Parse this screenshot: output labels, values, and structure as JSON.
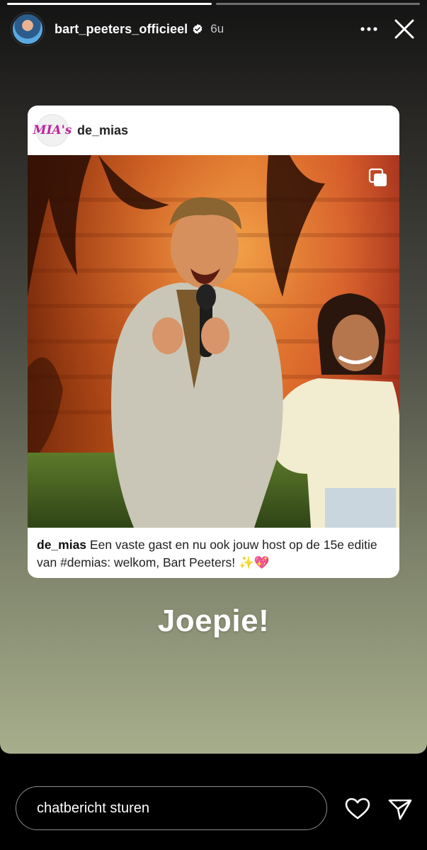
{
  "story": {
    "progress": [
      1.0,
      0.0
    ],
    "header": {
      "username": "bart_peeters_officieel",
      "time": "6u",
      "verified_icon": "verified-badge-icon",
      "more_icon": "more-horizontal-icon",
      "close_icon": "close-icon"
    },
    "shared_post": {
      "username": "de_mias",
      "logo_text": "MIA's",
      "caption_user": "de_mias",
      "caption_text": " Een vaste gast en nu ook jouw host op de 15e editie van #demias: welkom, Bart Peeters! ✨💖",
      "carousel_icon": "carousel-icon"
    },
    "sticker_text": "Joepie!"
  },
  "reply": {
    "placeholder": "chatbericht sturen",
    "heart_icon": "heart-icon",
    "send_icon": "send-icon"
  }
}
